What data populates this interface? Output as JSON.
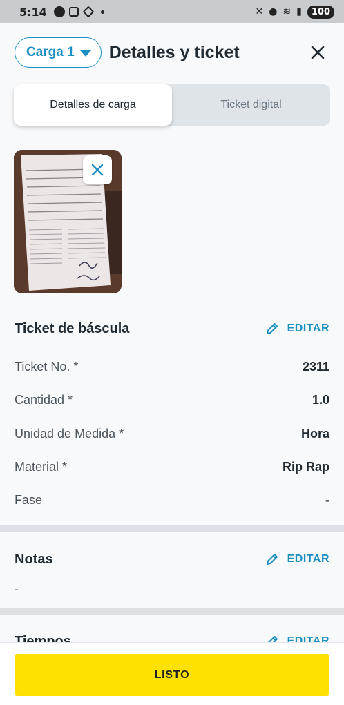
{
  "status_bar": {
    "time": "5:14",
    "battery": "100"
  },
  "header": {
    "load_selector": "Carga 1",
    "title": "Detalles y ticket"
  },
  "tabs": [
    {
      "label": "Detalles de carga",
      "active": true
    },
    {
      "label": "Ticket digital",
      "active": false
    }
  ],
  "scale_ticket": {
    "title": "Ticket de báscula",
    "edit_label": "EDITAR",
    "fields": [
      {
        "label": "Ticket No. *",
        "value": "2311"
      },
      {
        "label": "Cantidad *",
        "value": "1.0"
      },
      {
        "label": "Unidad de Medida *",
        "value": "Hora"
      },
      {
        "label": "Material *",
        "value": "Rip Rap"
      },
      {
        "label": "Fase",
        "value": "-"
      }
    ]
  },
  "notes": {
    "title": "Notas",
    "edit_label": "EDITAR",
    "value": "-"
  },
  "times": {
    "title": "Tiempos",
    "edit_label": "EDITAR"
  },
  "footer": {
    "done_label": "LISTO"
  },
  "colors": {
    "accent": "#1c8fc2",
    "primary_button": "#ffe100",
    "divider": "#dde1e6"
  }
}
